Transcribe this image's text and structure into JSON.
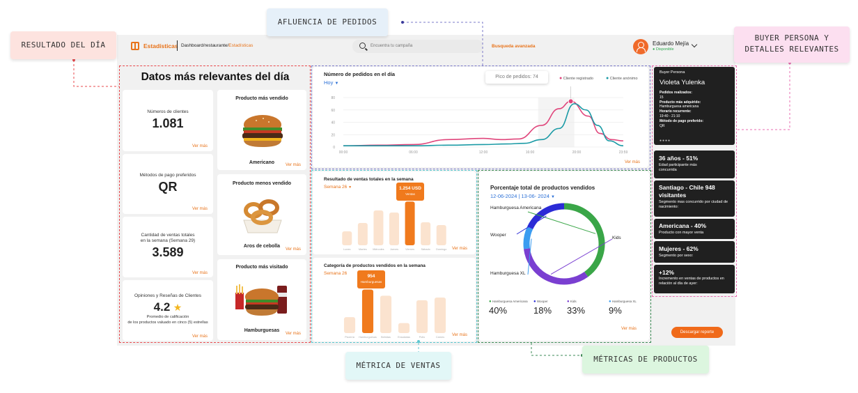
{
  "annotations": {
    "resultado": "RESULTADO DEL DÍA",
    "afluencia": "AFLUENCIA DE PEDIDOS",
    "buyer_line1": "BUYER PERSONA Y",
    "buyer_line2": "DETALLES RELEVANTES",
    "metrica_ventas": "MÉTRICA DE VENTAS",
    "metricas_productos": "MÉTRICAS DE PRODUCTOS"
  },
  "header": {
    "app_title": "Estadísticas",
    "breadcrumb_base": "Dashboard/restaurante/",
    "breadcrumb_current": "Estadísticas",
    "search_placeholder": "Encuentra tu campaña",
    "advanced_search": "Busqueda avanzada",
    "user_name": "Eduardo Mejía",
    "user_status": "Disponible"
  },
  "summary": {
    "title": "Datos más relevantes del día",
    "ver_mas": "Ver más",
    "clients_label": "Números de clientes",
    "clients_value": "1.081",
    "payment_label": "Métodos de pago preferidos",
    "payment_value": "QR",
    "sales_label_1": "Cantidad de ventas totales",
    "sales_label_2": "en la semana (Semana 29)",
    "sales_value": "3.589",
    "reviews_label": "Opiniones y Reseñas de Clientes",
    "reviews_value": "4.2",
    "reviews_sub_1": "Promedio de calificación",
    "reviews_sub_2": "de los productos valuado en cinco (5) estrellas",
    "prod_most_sold_title": "Producto más vendido",
    "prod_most_sold_name": "Americano",
    "prod_least_sold_title": "Producto menos vendido",
    "prod_least_sold_name": "Aros de cebolla",
    "prod_most_visited_title": "Producto más visitado",
    "prod_most_visited_name": "Hamburguesas"
  },
  "orders_chart": {
    "title": "Número de pedidos en el día",
    "period": "Hoy",
    "tooltip": "Pico de pedidos: 74",
    "legend": [
      "Cliente registrado",
      "Cliente anónimo"
    ],
    "ver_mas": "Ver más"
  },
  "weekly_sales": {
    "title": "Resultado de ventas totales en la semana",
    "period": "Semana 26",
    "tooltip_value": "1.254 USD",
    "tooltip_sub": "Ventas",
    "ver_mas": "Ver más"
  },
  "category_sales": {
    "title": "Categoría de productos vendidos en la semana",
    "period": "Semana 26",
    "tooltip_value": "954",
    "tooltip_sub": "Hamburguesas",
    "ver_mas": "Ver más"
  },
  "product_pct": {
    "title": "Porcentaje total de productos vendidos",
    "range": "12-06-2024 | 13-06- 2024",
    "ver_mas": "Ver más",
    "callouts": [
      "Hamburguesa Americana",
      "Wooper",
      "Kids",
      "Hamburguesa XL"
    ],
    "legend": [
      {
        "name": "Hamburguesa Americana",
        "pct": "40%",
        "color": "#3aa648"
      },
      {
        "name": "Wooper",
        "pct": "18%",
        "color": "#2b2bd6"
      },
      {
        "name": "Kids",
        "pct": "33%",
        "color": "#7a3fd1"
      },
      {
        "name": "Hamburguesa XL",
        "pct": "9%",
        "color": "#3b9cf0"
      }
    ]
  },
  "persona": {
    "heading": "Buyer Persona",
    "name": "Violeta Yulenka",
    "orders_label": "Pedidos realizados:",
    "orders_value": "15",
    "product_label": "Producto más adquirido:",
    "product_value": "Hamburguesa americana",
    "hours_label": "Horario recurrente:",
    "hours_value": "19:40 - 21:10",
    "pay_label": "Método de pago preferido:",
    "pay_value": "QR"
  },
  "insights": [
    {
      "title": "36 años - 51%",
      "sub": "Edad participante más concurrida"
    },
    {
      "title": "Santiago - Chile 948 visitantes",
      "sub": "Segmento mas concurrido por ciudad de nacimiento:"
    },
    {
      "title": "Americana - 40%",
      "sub": "Producto con mayor venta"
    },
    {
      "title": "Mujeres - 62%",
      "sub": "Segmento por sexo:"
    },
    {
      "title": "+12%",
      "sub": "Incremento en ventas de productos en relación al día de ayer:"
    }
  ],
  "download_button": "Descargar reporte",
  "chart_data": [
    {
      "type": "line",
      "title": "Número de pedidos en el día",
      "x": [
        "00:00",
        "06:00",
        "12:00",
        "16:00",
        "20:00",
        "23:59"
      ],
      "ylim": [
        0,
        80
      ],
      "y_ticks": [
        0,
        20,
        40,
        60,
        80
      ],
      "series": [
        {
          "name": "Cliente registrado",
          "color": "#e0457b",
          "points": [
            [
              0,
              2
            ],
            [
              3,
              3
            ],
            [
              6,
              4
            ],
            [
              9,
              12
            ],
            [
              12,
              14
            ],
            [
              13.5,
              12
            ],
            [
              15,
              13
            ],
            [
              17,
              35
            ],
            [
              18.5,
              62
            ],
            [
              19.5,
              74
            ],
            [
              21,
              50
            ],
            [
              22,
              22
            ],
            [
              23,
              12
            ],
            [
              24,
              10
            ]
          ]
        },
        {
          "name": "Cliente anónimo",
          "color": "#1a9aa5",
          "points": [
            [
              0,
              2
            ],
            [
              3,
              2
            ],
            [
              6,
              2
            ],
            [
              9,
              3
            ],
            [
              12,
              4
            ],
            [
              14,
              5
            ],
            [
              15.5,
              6
            ],
            [
              17,
              12
            ],
            [
              18.5,
              30
            ],
            [
              19.8,
              70
            ],
            [
              20.8,
              60
            ],
            [
              21.8,
              35
            ],
            [
              22.8,
              10
            ],
            [
              24,
              2
            ]
          ]
        }
      ]
    },
    {
      "type": "bar",
      "title": "Resultado de ventas totales en la semana",
      "categories": [
        "Lunes",
        "Martes",
        "Miércoles",
        "Jueves",
        "Viernes",
        "Sábado",
        "Domingo"
      ],
      "values": [
        400,
        640,
        1000,
        940,
        1254,
        660,
        580
      ],
      "highlight": 4,
      "ylim": [
        0,
        1400
      ]
    },
    {
      "type": "bar",
      "title": "Categoría de productos vendidos en la semana",
      "categories": [
        "Pizzería",
        "Hamburguesas",
        "Bebidas",
        "Ensaladas",
        "Pollo",
        "Carnes"
      ],
      "values": [
        350,
        954,
        820,
        220,
        720,
        780
      ],
      "highlight": 1,
      "ylim": [
        0,
        1100
      ]
    },
    {
      "type": "pie",
      "title": "Porcentaje total de productos vendidos",
      "labels": [
        "Hamburguesa Americana",
        "Kids",
        "Hamburguesa XL",
        "Wooper"
      ],
      "values": [
        40,
        33,
        9,
        18
      ],
      "colors": [
        "#3aa648",
        "#7a3fd1",
        "#3b9cf0",
        "#2b2bd6"
      ]
    }
  ]
}
